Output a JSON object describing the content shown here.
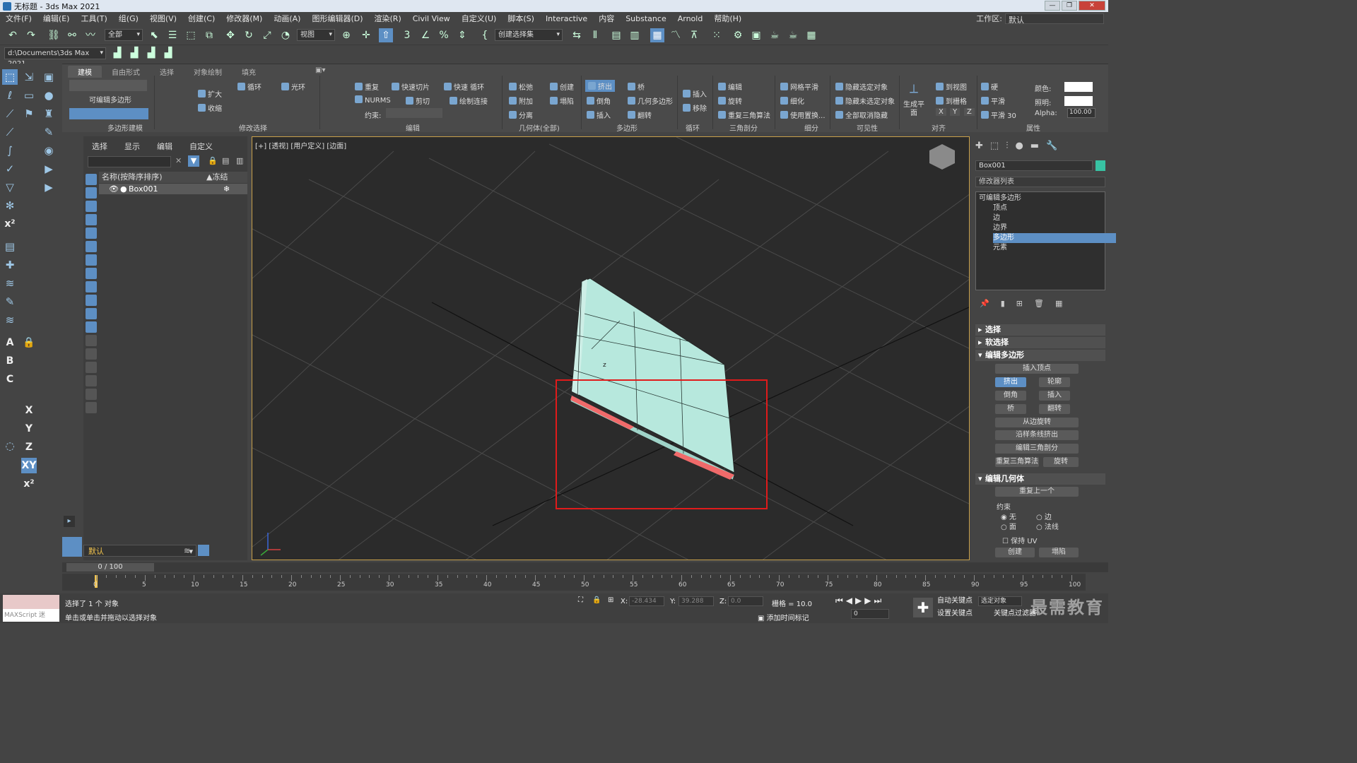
{
  "window": {
    "title": "无标题 - 3ds Max 2021"
  },
  "menu": [
    "文件(F)",
    "编辑(E)",
    "工具(T)",
    "组(G)",
    "视图(V)",
    "创建(C)",
    "修改器(M)",
    "动画(A)",
    "图形编辑器(D)",
    "渲染(R)",
    "Civil View",
    "自定义(U)",
    "脚本(S)",
    "Interactive",
    "内容",
    "Substance",
    "Arnold",
    "帮助(H)"
  ],
  "workspace": {
    "label": "工作区:",
    "value": "默认"
  },
  "toolbar": {
    "filter": "全部",
    "refcoord": "视图",
    "selset": "创建选择集",
    "path": "d:\\Documents\\3ds Max 2021"
  },
  "ribbon": {
    "tabs": [
      "建模",
      "自由形式",
      "选择",
      "对象绘制",
      "填充"
    ],
    "groups": [
      "多边形建模",
      "修改选择",
      "编辑",
      "几何体(全部)",
      "多边形",
      "循环",
      "三角剖分",
      "细分",
      "可见性",
      "对齐",
      "属性"
    ],
    "editable_poly": "可编辑多边形",
    "modsel": {
      "grow": "扩大",
      "shrink": "收缩",
      "loop": "循环",
      "ring": "光环"
    },
    "edit": {
      "repeat": "重复",
      "quickslice": "快速切片",
      "quickloop": "快速 循环",
      "nurms": "NURMS",
      "cut": "剪切",
      "paintconnect": "绘制连接",
      "constraint": "约束:"
    },
    "geom": {
      "relax": "松弛",
      "create": "创建",
      "attach": "附加",
      "collapse": "塌陷",
      "detach": "分离"
    },
    "poly": {
      "extrude": "挤出",
      "bridge": "桥",
      "bevel": "倒角",
      "geompoly": "几何多边形",
      "inset": "插入",
      "flip": "翻转"
    },
    "loop": {
      "insert": "插入",
      "remove": "移除"
    },
    "tri": {
      "edit": "编辑",
      "rotate": "旋转",
      "retri": "重复三角算法"
    },
    "subdiv": {
      "meshsmooth": "网格平滑",
      "tessellate": "细化",
      "usedisp": "使用置换..."
    },
    "vis": {
      "hidesel": "隐藏选定对象",
      "hideunsel": "隐藏未选定对象",
      "unhideall": "全部取消隐藏"
    },
    "align": {
      "makeplanar": "生成平面",
      "toview": "到视图",
      "togrid": "到栅格",
      "x": "X",
      "y": "Y",
      "z": "Z"
    },
    "props": {
      "hard": "硬",
      "smooth": "平滑",
      "smooth30": "平滑 30",
      "color": "颜色:",
      "illum": "照明:",
      "alpha": "Alpha:",
      "alpha_val": "100.00"
    }
  },
  "scene": {
    "tabs": [
      "选择",
      "显示",
      "编辑",
      "自定义"
    ],
    "header": "名称(按降序排序)",
    "header_freeze": "▲冻结",
    "rows": [
      "Box001"
    ],
    "layer": "默认"
  },
  "viewport": {
    "label": "[+] [透视] [用户定义] [边面]"
  },
  "command": {
    "object_name": "Box001",
    "modifier_list": "修改器列表",
    "stack": [
      "可编辑多边形",
      "顶点",
      "边",
      "边界",
      "多边形",
      "元素"
    ],
    "stack_selected": 4,
    "rollouts": {
      "select": "选择",
      "softsel": "软选择",
      "editpoly": "编辑多边形",
      "editgeom": "编辑几何体"
    },
    "editpoly_buttons": [
      "插入顶点",
      "挤出",
      "轮廓",
      "倒角",
      "插入",
      "桥",
      "翻转",
      "从边旋转",
      "沿样条线挤出",
      "编辑三角剖分",
      "重复三角算法",
      "旋转"
    ],
    "editgeom": {
      "repeat": "重复上一个",
      "constraint": "约束",
      "none": "无",
      "edge": "边",
      "face": "面",
      "normal": "法线",
      "preserve_uv": "保持 UV",
      "create": "创建",
      "collapse": "塌陷"
    }
  },
  "time": {
    "frame": "0 / 100",
    "ticks": [
      "0",
      "5",
      "10",
      "15",
      "20",
      "25",
      "30",
      "35",
      "40",
      "45",
      "50",
      "55",
      "60",
      "65",
      "70",
      "75",
      "80",
      "85",
      "90",
      "95",
      "100"
    ]
  },
  "status": {
    "maxscript": "MAXScript 迷",
    "selected": "选择了 1 个 对象",
    "hint": "单击或单击并拖动以选择对象",
    "x_label": "X:",
    "x": "-28.434",
    "y_label": "Y:",
    "y": "39.288",
    "z_label": "Z:",
    "z": "0.0",
    "grid": "栅格 = 10.0",
    "addkey": "添加时间标记",
    "autokey": "自动关键点",
    "selobj": "选定对象",
    "setkey": "设置关键点",
    "keyfilter": "关键点过滤器",
    "frame_val": "0",
    "watermark": "最需教育"
  }
}
